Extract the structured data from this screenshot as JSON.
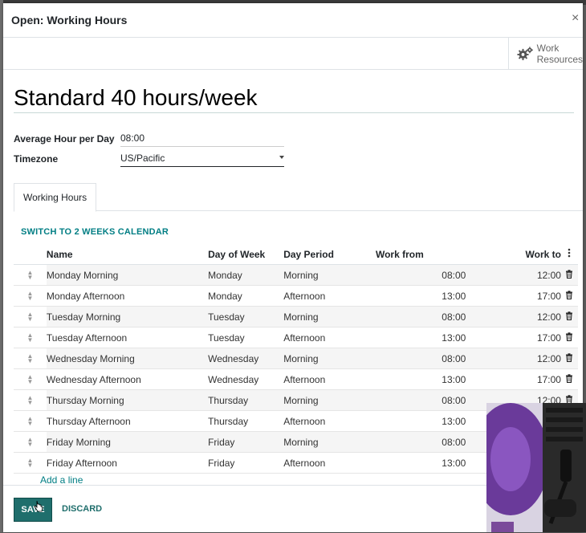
{
  "dialog": {
    "title": "Open: Working Hours",
    "close_symbol": "×"
  },
  "smart_button": {
    "icon": "gear-icon",
    "line1": "Work",
    "line2": "Resources"
  },
  "record": {
    "name": "Standard 40 hours/week",
    "fields": [
      {
        "label": "Average Hour per Day",
        "value": "08:00"
      },
      {
        "label": "Timezone",
        "value": "US/Pacific"
      }
    ]
  },
  "tabs": [
    {
      "label": "Working Hours",
      "active": true
    }
  ],
  "switch_link": "SWITCH TO 2 WEEKS CALENDAR",
  "table": {
    "columns": [
      "Name",
      "Day of Week",
      "Day Period",
      "Work from",
      "Work to"
    ],
    "rows": [
      {
        "name": "Monday Morning",
        "day": "Monday",
        "period": "Morning",
        "from": "08:00",
        "to": "12:00"
      },
      {
        "name": "Monday Afternoon",
        "day": "Monday",
        "period": "Afternoon",
        "from": "13:00",
        "to": "17:00"
      },
      {
        "name": "Tuesday Morning",
        "day": "Tuesday",
        "period": "Morning",
        "from": "08:00",
        "to": "12:00"
      },
      {
        "name": "Tuesday Afternoon",
        "day": "Tuesday",
        "period": "Afternoon",
        "from": "13:00",
        "to": "17:00"
      },
      {
        "name": "Wednesday Morning",
        "day": "Wednesday",
        "period": "Morning",
        "from": "08:00",
        "to": "12:00"
      },
      {
        "name": "Wednesday Afternoon",
        "day": "Wednesday",
        "period": "Afternoon",
        "from": "13:00",
        "to": "17:00"
      },
      {
        "name": "Thursday Morning",
        "day": "Thursday",
        "period": "Morning",
        "from": "08:00",
        "to": "12:00"
      },
      {
        "name": "Thursday Afternoon",
        "day": "Thursday",
        "period": "Afternoon",
        "from": "13:00",
        "to": ""
      },
      {
        "name": "Friday Morning",
        "day": "Friday",
        "period": "Morning",
        "from": "08:00",
        "to": ""
      },
      {
        "name": "Friday Afternoon",
        "day": "Friday",
        "period": "Afternoon",
        "from": "13:00",
        "to": ""
      }
    ],
    "add_line": "Add a line"
  },
  "footer": {
    "save_label": "SAVE",
    "discard_label": "DISCARD"
  },
  "colors": {
    "accent": "#017e84",
    "primary_button": "#1f6e6c"
  }
}
